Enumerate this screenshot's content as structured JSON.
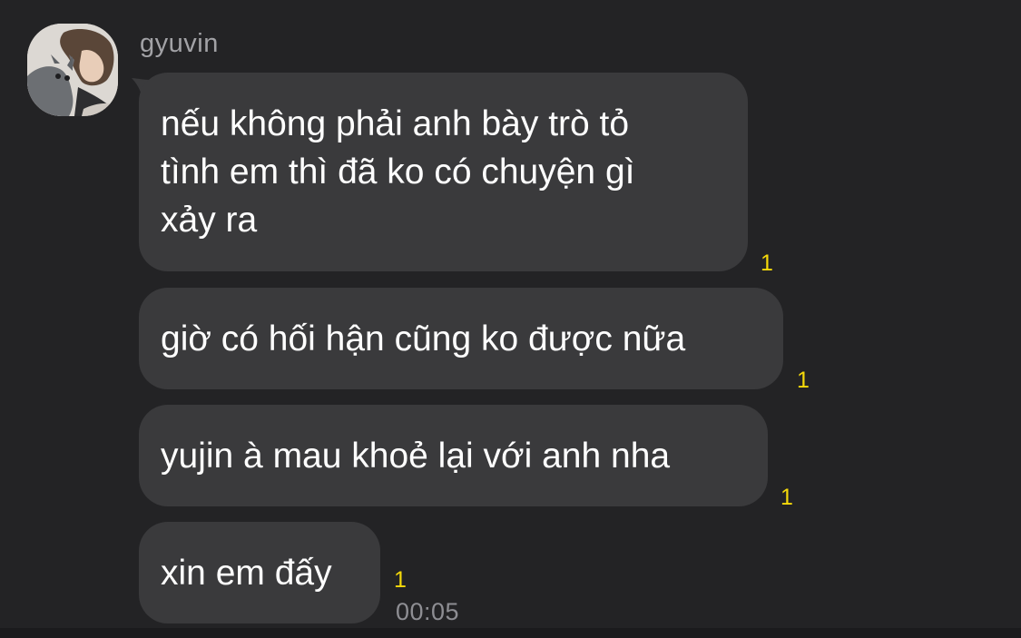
{
  "chat": {
    "sender_name": "gyuvin",
    "avatar_icon": "profile-photo-with-cat",
    "messages": [
      {
        "lines": [
          "nếu không phải anh bày trò tỏ",
          "tình em thì đã ko có chuyện gì",
          "xảy ra"
        ],
        "unread": "1"
      },
      {
        "lines": [
          "giờ có hối hận cũng ko được nữa"
        ],
        "unread": "1"
      },
      {
        "lines": [
          "yujin à mau khoẻ lại với anh nha"
        ],
        "unread": "1"
      },
      {
        "lines": [
          "xin em đấy"
        ],
        "unread": "1",
        "time": "00:05"
      }
    ]
  },
  "colors": {
    "background": "#232325",
    "bubble": "#3a3a3c",
    "unread": "#f5d90a",
    "sender_text": "#a2a2a6",
    "time_text": "#8e8e93"
  }
}
